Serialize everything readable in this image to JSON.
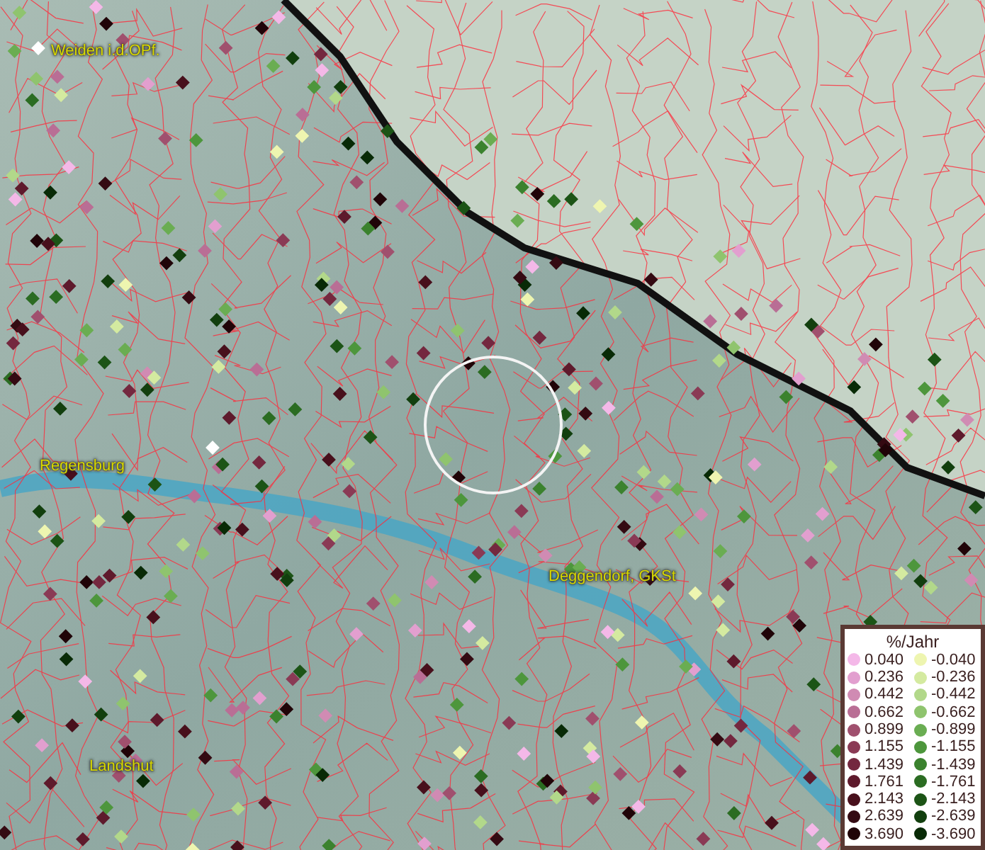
{
  "map": {
    "places": [
      {
        "name": "Weiden i.d.OPf.",
        "kind": "city"
      },
      {
        "name": "Regensburg",
        "kind": "city"
      },
      {
        "name": "Deggendorf, GKSt",
        "kind": "city"
      },
      {
        "name": "Landshut",
        "kind": "city"
      }
    ]
  },
  "legend": {
    "title": "%/Jahr",
    "positive": [
      {
        "label": "0.040",
        "color": "#f4b8e8"
      },
      {
        "label": "0.236",
        "color": "#e29fcf"
      },
      {
        "label": "0.442",
        "color": "#d08bb3"
      },
      {
        "label": "0.662",
        "color": "#b96e95"
      },
      {
        "label": "0.899",
        "color": "#a0506e"
      },
      {
        "label": "1.155",
        "color": "#8a3a55"
      },
      {
        "label": "1.439",
        "color": "#74283f"
      },
      {
        "label": "1.761",
        "color": "#5e1a2c"
      },
      {
        "label": "2.143",
        "color": "#48101c"
      },
      {
        "label": "2.639",
        "color": "#340a12"
      },
      {
        "label": "3.690",
        "color": "#200408"
      }
    ],
    "negative": [
      {
        "label": "-0.040",
        "color": "#eef5b0"
      },
      {
        "label": "-0.236",
        "color": "#d4eaa0"
      },
      {
        "label": "-0.442",
        "color": "#b2d88a"
      },
      {
        "label": "-0.662",
        "color": "#8fc46e"
      },
      {
        "label": "-0.899",
        "color": "#6aad52"
      },
      {
        "label": "-1.155",
        "color": "#4d963c"
      },
      {
        "label": "-1.439",
        "color": "#3b822e"
      },
      {
        "label": "-1.761",
        "color": "#2b6c22"
      },
      {
        "label": "-2.143",
        "color": "#1c5416"
      },
      {
        "label": "-2.639",
        "color": "#123f0e"
      },
      {
        "label": "-3.690",
        "color": "#082a06"
      }
    ]
  }
}
